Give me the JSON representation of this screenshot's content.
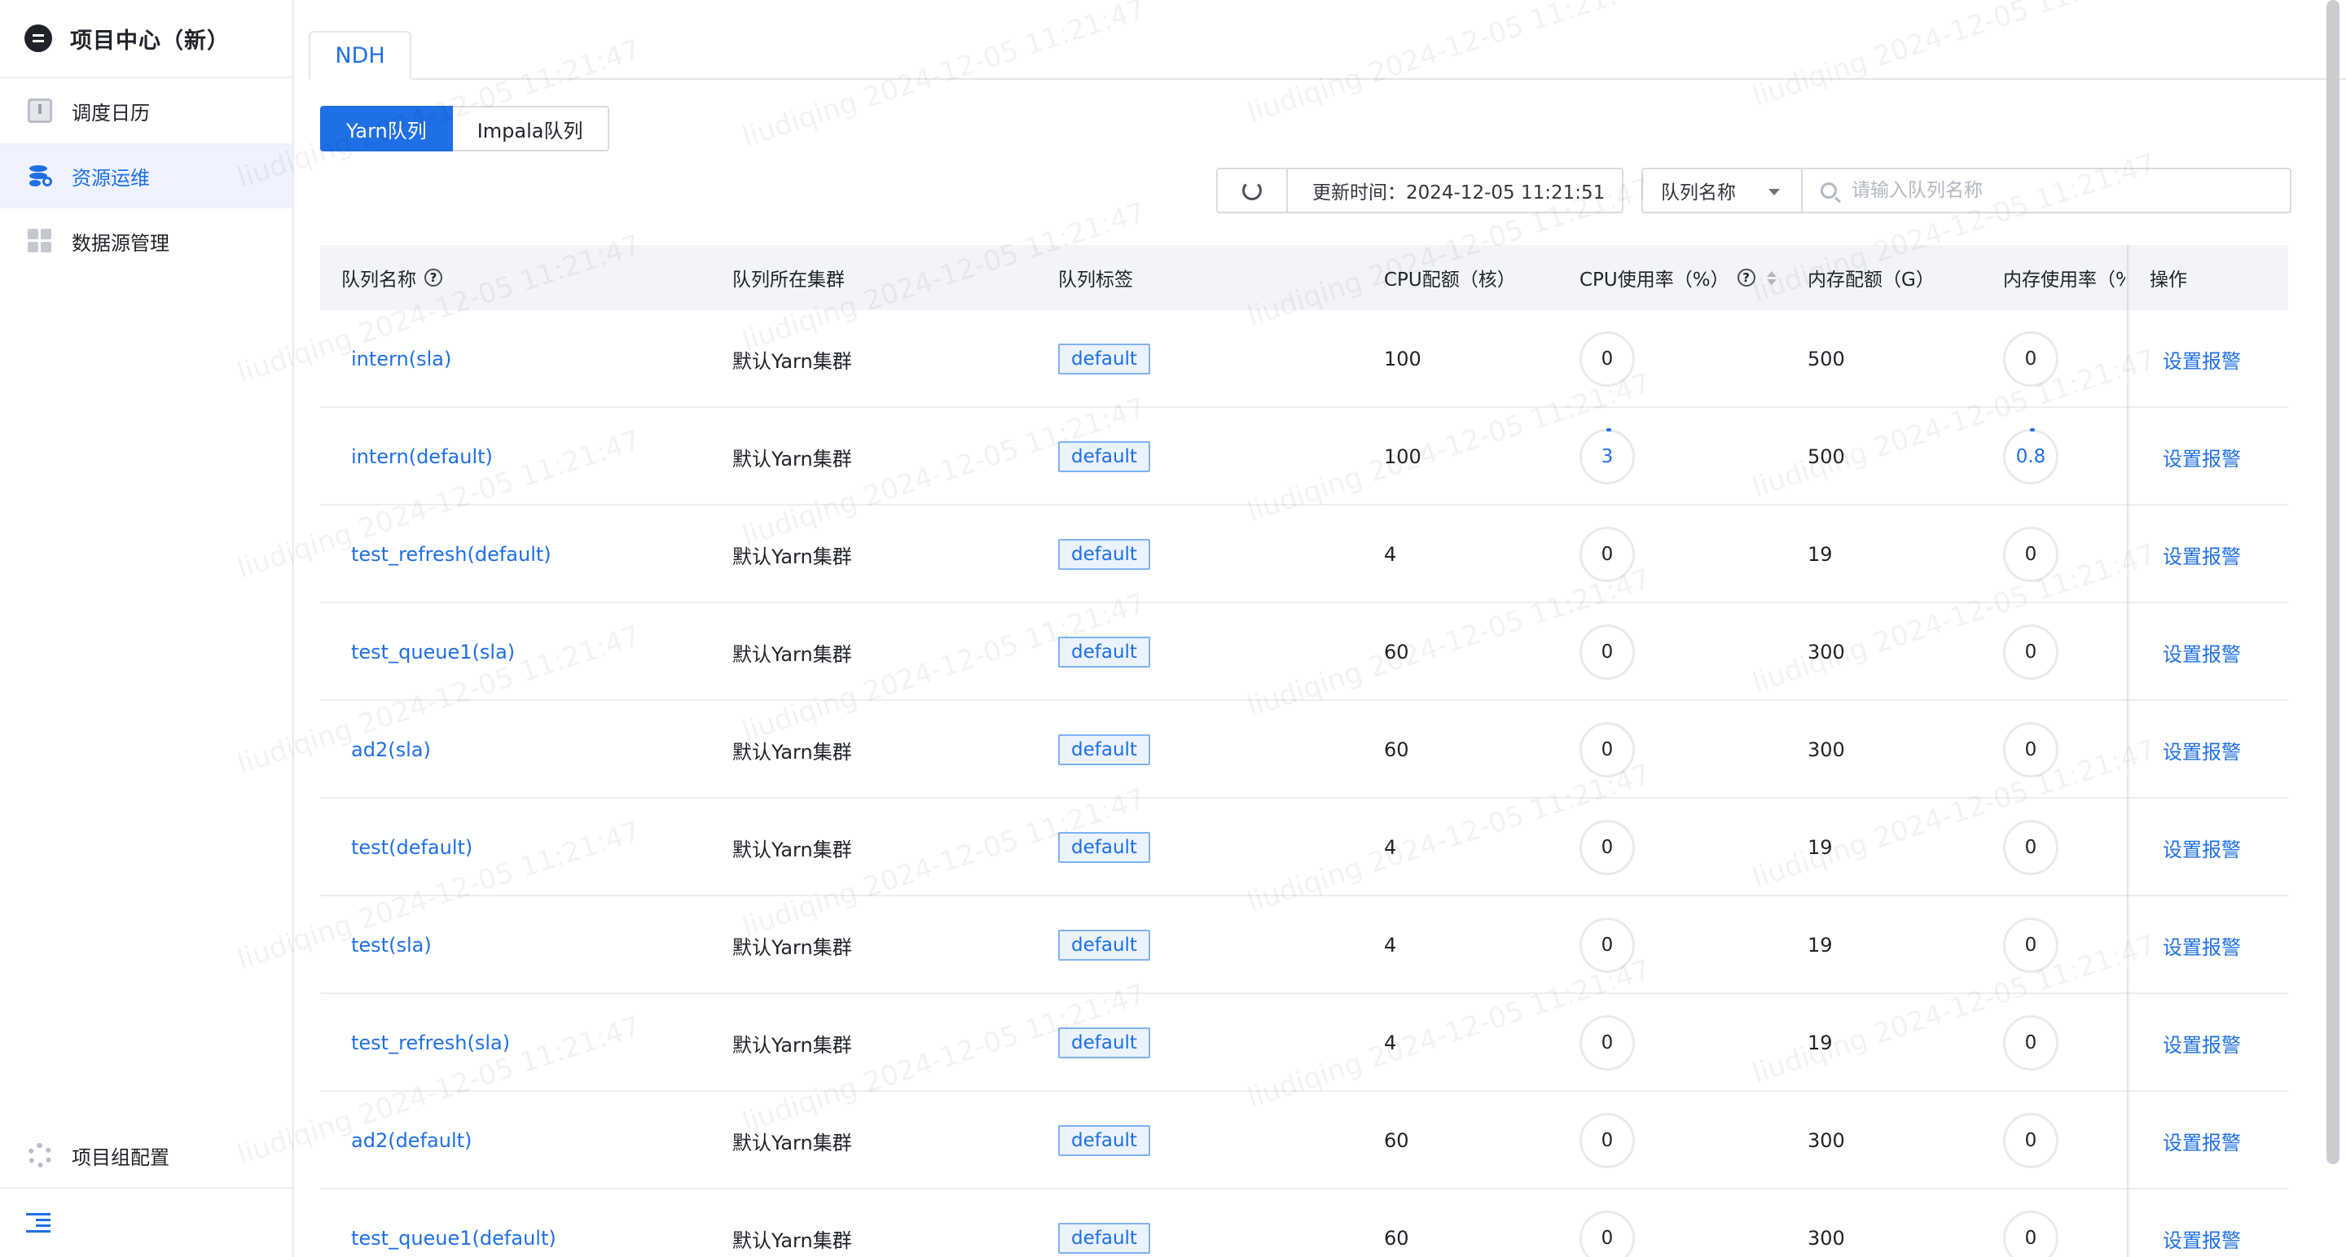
{
  "app": {
    "title": "项目中心（新）"
  },
  "sidebar": {
    "items": [
      {
        "label": "调度日历",
        "icon": "calendar-icon",
        "active": false
      },
      {
        "label": "资源运维",
        "icon": "database-settings-icon",
        "active": true
      },
      {
        "label": "数据源管理",
        "icon": "grid-icon",
        "active": false
      }
    ],
    "config_label": "项目组配置",
    "collapse_icon": "collapse-menu-icon"
  },
  "tabs": [
    {
      "label": "NDH",
      "active": true
    }
  ],
  "queue_types": [
    {
      "label": "Yarn队列",
      "active": true
    },
    {
      "label": "Impala队列",
      "active": false
    }
  ],
  "toolbar": {
    "update_time": "更新时间：2024-12-05 11:21:51",
    "filter_select": "队列名称",
    "search_placeholder": "请输入队列名称"
  },
  "table": {
    "columns": [
      "队列名称",
      "队列所在集群",
      "队列标签",
      "CPU配额（核）",
      "CPU使用率（%）",
      "内存配额（G）",
      "内存使用率（%",
      "操作"
    ],
    "rows": [
      {
        "name": "intern(sla)",
        "cluster": "默认Yarn集群",
        "tag": "default",
        "cpu_quota": "100",
        "cpu_usage": "0",
        "mem_quota": "500",
        "mem_usage": "0",
        "action": "设置报警"
      },
      {
        "name": "intern(default)",
        "cluster": "默认Yarn集群",
        "tag": "default",
        "cpu_quota": "100",
        "cpu_usage": "3",
        "mem_quota": "500",
        "mem_usage": "0.8",
        "action": "设置报警"
      },
      {
        "name": "test_refresh(default)",
        "cluster": "默认Yarn集群",
        "tag": "default",
        "cpu_quota": "4",
        "cpu_usage": "0",
        "mem_quota": "19",
        "mem_usage": "0",
        "action": "设置报警"
      },
      {
        "name": "test_queue1(sla)",
        "cluster": "默认Yarn集群",
        "tag": "default",
        "cpu_quota": "60",
        "cpu_usage": "0",
        "mem_quota": "300",
        "mem_usage": "0",
        "action": "设置报警"
      },
      {
        "name": "ad2(sla)",
        "cluster": "默认Yarn集群",
        "tag": "default",
        "cpu_quota": "60",
        "cpu_usage": "0",
        "mem_quota": "300",
        "mem_usage": "0",
        "action": "设置报警"
      },
      {
        "name": "test(default)",
        "cluster": "默认Yarn集群",
        "tag": "default",
        "cpu_quota": "4",
        "cpu_usage": "0",
        "mem_quota": "19",
        "mem_usage": "0",
        "action": "设置报警"
      },
      {
        "name": "test(sla)",
        "cluster": "默认Yarn集群",
        "tag": "default",
        "cpu_quota": "4",
        "cpu_usage": "0",
        "mem_quota": "19",
        "mem_usage": "0",
        "action": "设置报警"
      },
      {
        "name": "test_refresh(sla)",
        "cluster": "默认Yarn集群",
        "tag": "default",
        "cpu_quota": "4",
        "cpu_usage": "0",
        "mem_quota": "19",
        "mem_usage": "0",
        "action": "设置报警"
      },
      {
        "name": "ad2(default)",
        "cluster": "默认Yarn集群",
        "tag": "default",
        "cpu_quota": "60",
        "cpu_usage": "0",
        "mem_quota": "300",
        "mem_usage": "0",
        "action": "设置报警"
      },
      {
        "name": "test_queue1(default)",
        "cluster": "默认Yarn集群",
        "tag": "default",
        "cpu_quota": "60",
        "cpu_usage": "0",
        "mem_quota": "300",
        "mem_usage": "0",
        "action": "设置报警"
      }
    ]
  },
  "watermark": "liudiqing 2024-12-05 11:21:47",
  "colors": {
    "accent": "#1f6fe6",
    "header_bg": "#f2f4f7",
    "active_nav_bg": "#eef3fe"
  }
}
